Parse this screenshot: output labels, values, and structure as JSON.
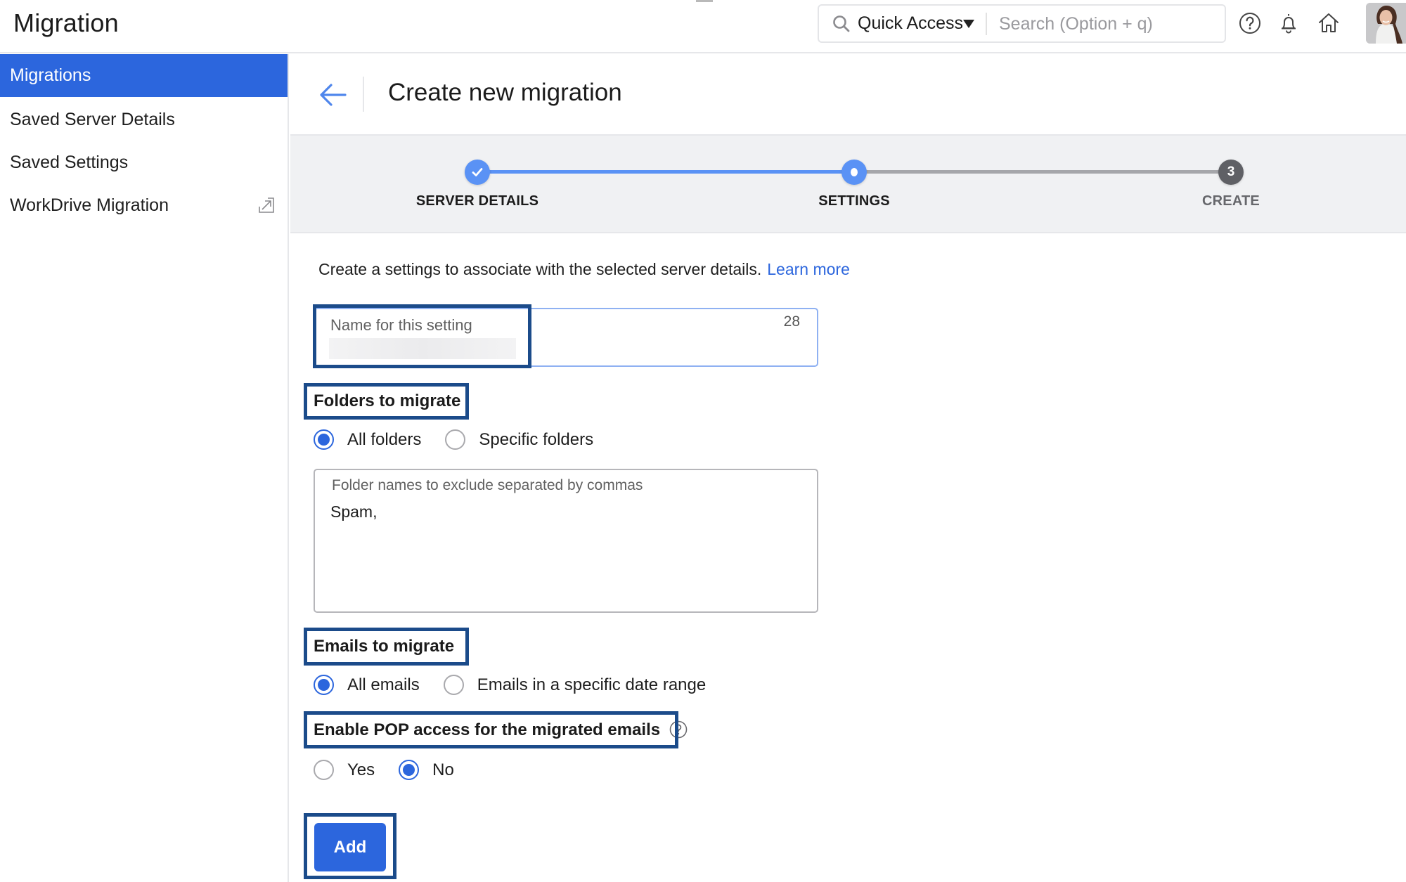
{
  "app": {
    "title": "Migration"
  },
  "topbar": {
    "quick_access_label": "Quick Access",
    "search_placeholder": "Search (Option + q)",
    "icons": [
      "help-icon",
      "bell-icon",
      "home-icon"
    ],
    "avatar_alt": "user-avatar"
  },
  "sidebar": {
    "items": [
      {
        "label": "Migrations",
        "active": true
      },
      {
        "label": "Saved Server Details",
        "active": false
      },
      {
        "label": "Saved Settings",
        "active": false
      },
      {
        "label": "WorkDrive Migration",
        "active": false,
        "icon": "external-link-icon"
      }
    ]
  },
  "page": {
    "title": "Create new migration",
    "back_icon": "arrow-left-icon"
  },
  "stepper": {
    "steps": [
      {
        "label": "SERVER DETAILS",
        "state": "completed",
        "marker": "check"
      },
      {
        "label": "SETTINGS",
        "state": "current",
        "marker": "dot"
      },
      {
        "label": "CREATE",
        "state": "pending",
        "marker": "3"
      }
    ],
    "colors": {
      "active": "#5a92f5",
      "pending": "#5f6065",
      "pending_line": "#a5a6aa"
    }
  },
  "form": {
    "description": "Create a settings to associate with the selected server details.",
    "learn_more": "Learn more",
    "name_field": {
      "label": "Name for this setting",
      "value": "",
      "remaining_chars": "28"
    },
    "folders": {
      "heading": "Folders to migrate",
      "options": [
        {
          "label": "All folders",
          "checked": true
        },
        {
          "label": "Specific folders",
          "checked": false
        }
      ],
      "exclude_label": "Folder names to exclude separated by commas",
      "exclude_value": "Spam,"
    },
    "emails": {
      "heading": "Emails to migrate",
      "options": [
        {
          "label": "All emails",
          "checked": true
        },
        {
          "label": "Emails in a specific date range",
          "checked": false
        }
      ]
    },
    "pop": {
      "heading": "Enable POP access for the migrated emails",
      "options": [
        {
          "label": "Yes",
          "checked": false
        },
        {
          "label": "No",
          "checked": true
        }
      ]
    },
    "add_button": "Add"
  },
  "colors": {
    "primary": "#2c66dd",
    "highlight_border": "#1b4b8a",
    "stepper_bg": "#f0f1f3"
  }
}
